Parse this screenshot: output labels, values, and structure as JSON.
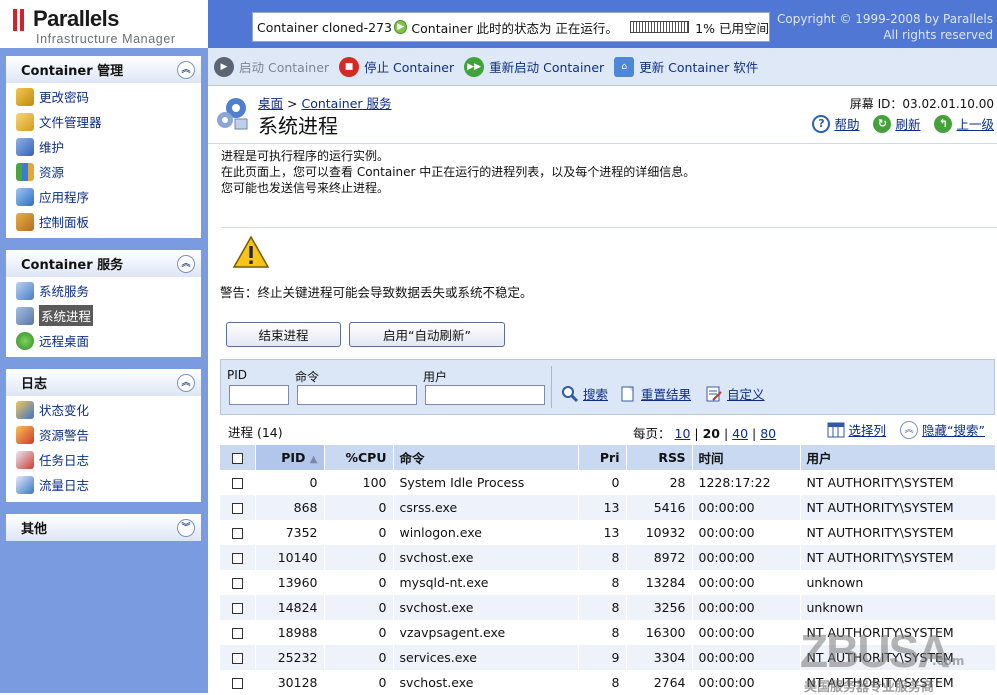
{
  "header": {
    "logo_name": "Parallels",
    "logo_sub": "Infrastructure Manager",
    "status_container": "Container cloned-273",
    "status_text": "Container 此时的状态为 正在运行。",
    "usage_text": "1% 已用空间",
    "usage_percent": 1,
    "copyright_line1": "Copyright © 1999-2008 by Parallels",
    "copyright_line2": "All rights reserved"
  },
  "sidebar": {
    "sections": [
      {
        "title": "Container 管理",
        "items": [
          {
            "label": "更改密码",
            "icon": "key-icon"
          },
          {
            "label": "文件管理器",
            "icon": "folder-icon"
          },
          {
            "label": "维护",
            "icon": "maintenance-icon"
          },
          {
            "label": "资源",
            "icon": "resources-icon"
          },
          {
            "label": "应用程序",
            "icon": "applications-icon"
          },
          {
            "label": "控制面板",
            "icon": "control-panel-icon"
          }
        ]
      },
      {
        "title": "Container 服务",
        "items": [
          {
            "label": "系统服务",
            "icon": "system-services-icon"
          },
          {
            "label": "系统进程",
            "icon": "system-processes-icon"
          },
          {
            "label": "远程桌面",
            "icon": "remote-desktop-icon"
          }
        ]
      },
      {
        "title": "日志",
        "items": [
          {
            "label": "状态变化",
            "icon": "status-change-icon"
          },
          {
            "label": "资源警告",
            "icon": "resource-alert-icon"
          },
          {
            "label": "任务日志",
            "icon": "task-log-icon"
          },
          {
            "label": "流量日志",
            "icon": "traffic-log-icon"
          }
        ]
      },
      {
        "title": "其他",
        "items": []
      }
    ]
  },
  "toolbar": {
    "start": "启动 Container",
    "stop": "停止 Container",
    "restart": "重新启动 Container",
    "update": "更新 Container 软件"
  },
  "page": {
    "breadcrumb_home": "桌面",
    "breadcrumb_sep": ">",
    "breadcrumb_section": "Container 服务",
    "title": "系统进程",
    "screen_id": "屏幕 ID：03.02.01.10.00",
    "help": "帮助",
    "refresh": "刷新",
    "up": "上一级"
  },
  "content": {
    "intro_line1": "进程是可执行程序的运行实例。",
    "intro_line2": "在此页面上，您可以查看 Container 中正在运行的进程列表，以及每个进程的详细信息。",
    "intro_line3": "您可能也发送信号来终止进程。",
    "warning": "警告：终止关键进程可能会导致数据丢失或系统不稳定。",
    "end_process_button": "结束进程",
    "auto_refresh_button": "启用“自动刷新”"
  },
  "search": {
    "pid_label": "PID",
    "command_label": "命令",
    "user_label": "用户",
    "search_action": "搜索",
    "reset_action": "重置结果",
    "customize_action": "自定义"
  },
  "list": {
    "count_label": "进程 (14)",
    "per_page_label": "每页：",
    "page_sizes": [
      "10",
      "20",
      "40",
      "80"
    ],
    "select_columns": "选择列",
    "hide_search": "隐藏“搜索”",
    "columns": [
      "PID",
      "%CPU",
      "命令",
      "Pri",
      "RSS",
      "时间",
      "用户"
    ],
    "rows": [
      [
        "0",
        "100",
        "System Idle Process",
        "0",
        "28",
        "1228:17:22",
        "NT AUTHORITY\\SYSTEM"
      ],
      [
        "868",
        "0",
        "csrss.exe",
        "13",
        "5416",
        "00:00:00",
        "NT AUTHORITY\\SYSTEM"
      ],
      [
        "7352",
        "0",
        "winlogon.exe",
        "13",
        "10932",
        "00:00:00",
        "NT AUTHORITY\\SYSTEM"
      ],
      [
        "10140",
        "0",
        "svchost.exe",
        "8",
        "8972",
        "00:00:00",
        "NT AUTHORITY\\SYSTEM"
      ],
      [
        "13960",
        "0",
        "mysqld-nt.exe",
        "8",
        "13284",
        "00:00:00",
        "unknown"
      ],
      [
        "14824",
        "0",
        "svchost.exe",
        "8",
        "3256",
        "00:00:00",
        "unknown"
      ],
      [
        "18988",
        "0",
        "vzavpsagent.exe",
        "8",
        "16300",
        "00:00:00",
        "NT AUTHORITY\\SYSTEM"
      ],
      [
        "25232",
        "0",
        "services.exe",
        "9",
        "3304",
        "00:00:00",
        "NT AUTHORITY\\SYSTEM"
      ],
      [
        "30128",
        "0",
        "svchost.exe",
        "8",
        "2764",
        "00:00:00",
        "NT AUTHORITY\\SYSTEM"
      ]
    ]
  },
  "watermark": {
    "main": "ZBUSA",
    "dotcom": ".com",
    "sub": "美国服务器专业服务商"
  }
}
